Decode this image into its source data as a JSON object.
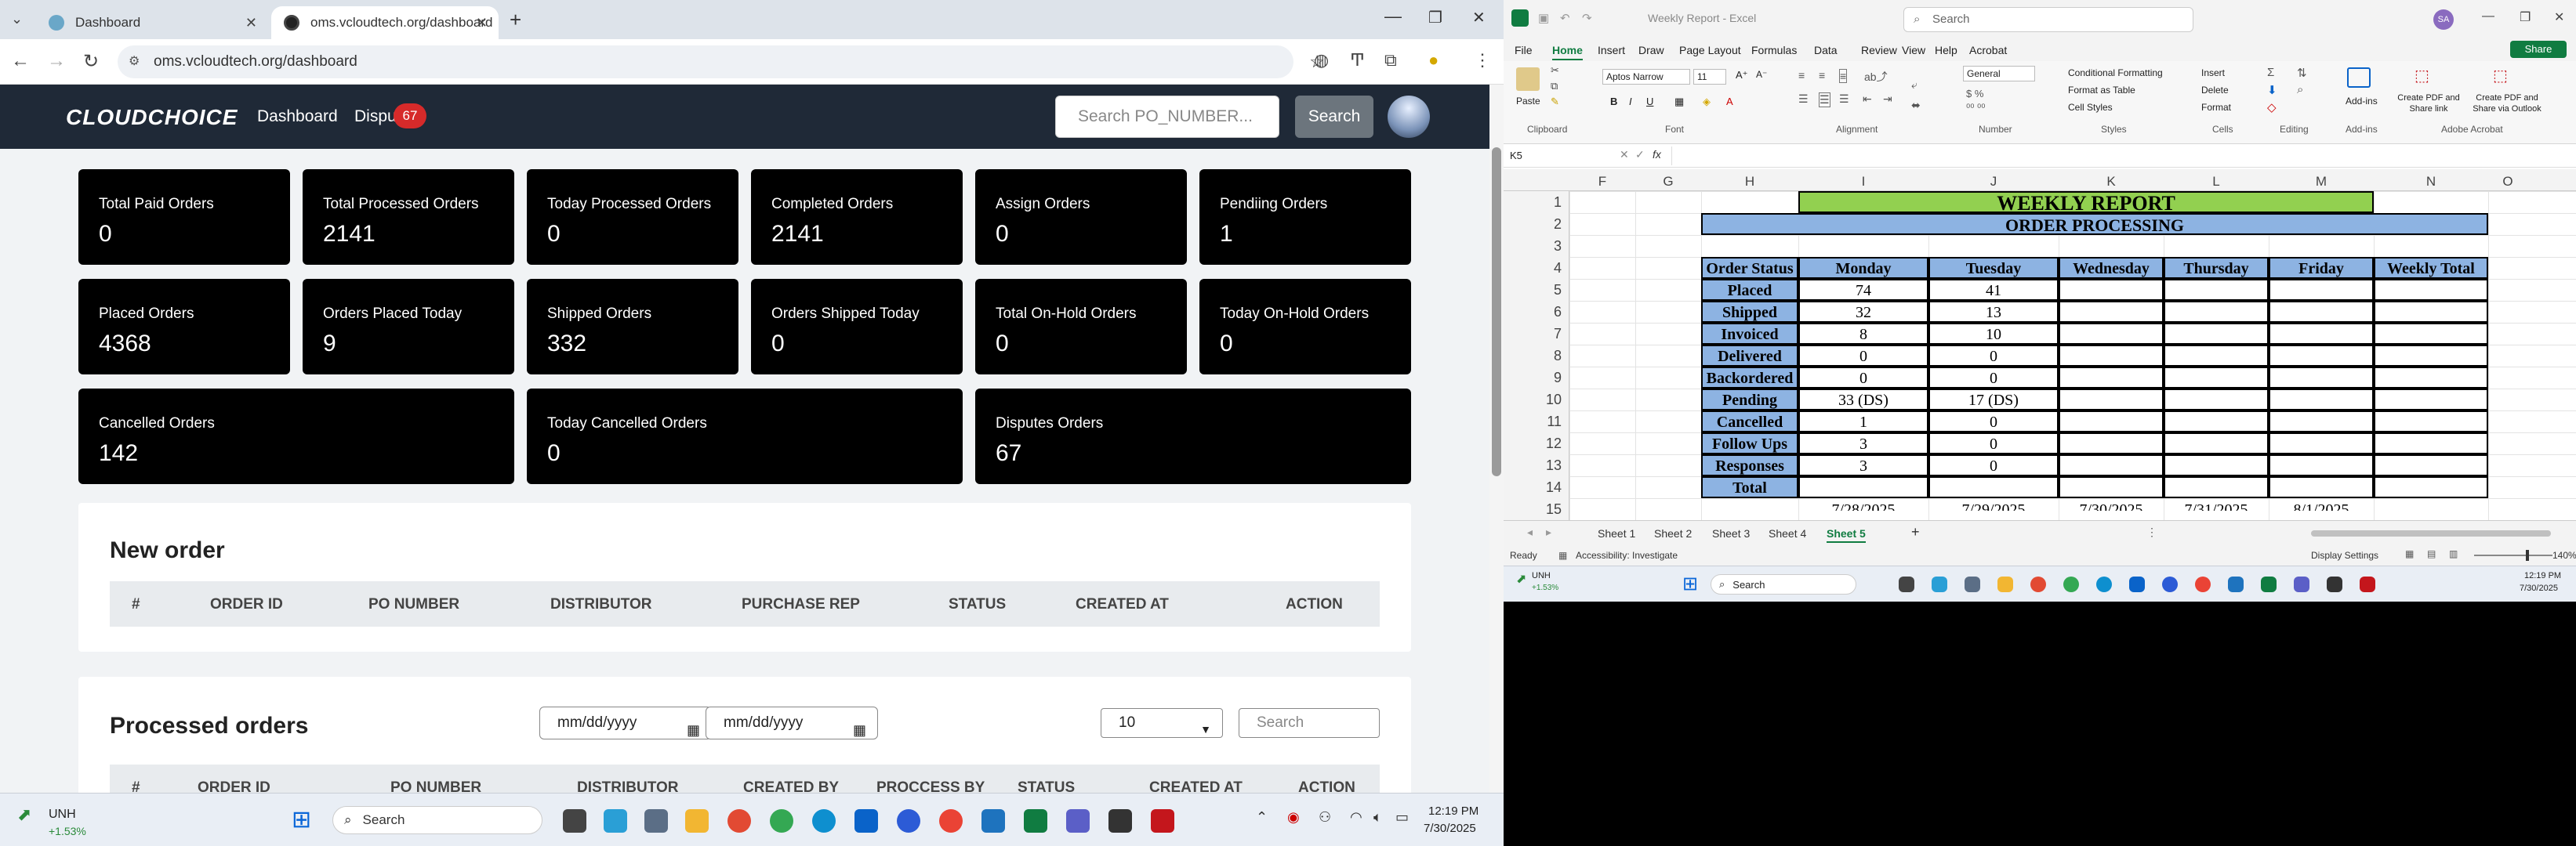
{
  "browser": {
    "tabs": [
      {
        "title": "Dashboard",
        "active": false
      },
      {
        "title": "oms.vcloudtech.org/dashboard",
        "active": true
      }
    ],
    "new_tab": "+",
    "url": "oms.vcloudtech.org/dashboard"
  },
  "app": {
    "logo": "CLOUDCHOICE",
    "nav": {
      "dashboard": "Dashboard",
      "disputes": "Dispu",
      "disputes_badge": "67"
    },
    "search_placeholder": "Search PO_NUMBER...",
    "search_button": "Search"
  },
  "cards": [
    {
      "label": "Total Paid Orders",
      "value": "0"
    },
    {
      "label": "Total Processed Orders",
      "value": "2141"
    },
    {
      "label": "Today Processed Orders",
      "value": "0"
    },
    {
      "label": "Completed Orders",
      "value": "2141"
    },
    {
      "label": "Assign Orders",
      "value": "0"
    },
    {
      "label": "Pendiing Orders",
      "value": "1"
    },
    {
      "label": "Placed Orders",
      "value": "4368"
    },
    {
      "label": "Orders Placed Today",
      "value": "9"
    },
    {
      "label": "Shipped Orders",
      "value": "332"
    },
    {
      "label": "Orders Shipped Today",
      "value": "0"
    },
    {
      "label": "Total On-Hold Orders",
      "value": "0"
    },
    {
      "label": "Today On-Hold Orders",
      "value": "0"
    },
    {
      "label": "Cancelled Orders",
      "value": "142"
    },
    {
      "label": "Today Cancelled Orders",
      "value": "0"
    },
    {
      "label": "Disputes Orders",
      "value": "67"
    }
  ],
  "new_order": {
    "title": "New order",
    "columns": [
      "#",
      "ORDER ID",
      "PO NUMBER",
      "DISTRIBUTOR",
      "PURCHASE REP",
      "STATUS",
      "CREATED AT",
      "ACTION"
    ]
  },
  "processed": {
    "title": "Processed orders",
    "date_from": "mm/dd/yyyy",
    "date_to": "mm/dd/yyyy",
    "page_size": "10",
    "search_placeholder": "Search",
    "columns": [
      "#",
      "ORDER ID",
      "PO NUMBER",
      "DISTRIBUTOR",
      "CREATED BY",
      "PROCCESS BY",
      "STATUS",
      "CREATED AT",
      "ACTION"
    ]
  },
  "taskbar": {
    "stock_name": "UNH",
    "stock_change": "+1.53%",
    "search": "Search",
    "time": "12:19 PM",
    "date": "7/30/2025"
  },
  "excel": {
    "title": "Weekly Report - Excel",
    "search": "Search",
    "user_initials": "SA",
    "menu": [
      "File",
      "Home",
      "Insert",
      "Draw",
      "Page Layout",
      "Formulas",
      "Data",
      "Review",
      "View",
      "Help",
      "Acrobat"
    ],
    "share": "Share",
    "ribbon": {
      "paste": "Paste",
      "clipboard": "Clipboard",
      "font_name": "Aptos Narrow",
      "font_size": "11",
      "font": "Font",
      "alignment": "Alignment",
      "number_format": "General",
      "number": "Number",
      "conditional_formatting": "Conditional Formatting",
      "format_as_table": "Format as Table",
      "cell_styles": "Cell Styles",
      "styles": "Styles",
      "insert": "Insert",
      "delete": "Delete",
      "format": "Format",
      "cells": "Cells",
      "editing": "Editing",
      "addins": "Add-ins",
      "addins_label": "Add-ins",
      "create_pdf_share": "Create PDF and Share link",
      "create_pdf_outlook": "Create PDF and Share via Outlook",
      "adobe_acrobat": "Adobe Acrobat"
    },
    "name_box": "K5",
    "fx": "fx",
    "columns": [
      "F",
      "G",
      "H",
      "I",
      "J",
      "K",
      "L",
      "M",
      "N",
      "O"
    ],
    "rows": [
      "1",
      "2",
      "3",
      "4",
      "5",
      "6",
      "7",
      "8",
      "9",
      "10",
      "11",
      "12",
      "13",
      "14",
      "15"
    ],
    "report_title": "WEEKLY REPORT",
    "report_subtitle": "ORDER PROCESSING",
    "table_header": [
      "Order Status",
      "Monday",
      "Tuesday",
      "Wednesday",
      "Thursday",
      "Friday",
      "Weekly Total"
    ],
    "table_rows": [
      [
        "Placed",
        "74",
        "41",
        "",
        "",
        "",
        ""
      ],
      [
        "Shipped",
        "32",
        "13",
        "",
        "",
        "",
        ""
      ],
      [
        "Invoiced",
        "8",
        "10",
        "",
        "",
        "",
        ""
      ],
      [
        "Delivered",
        "0",
        "0",
        "",
        "",
        "",
        ""
      ],
      [
        "Backordered",
        "0",
        "0",
        "",
        "",
        "",
        ""
      ],
      [
        "Pending",
        "33 (DS)",
        "17 (DS)",
        "",
        "",
        "",
        ""
      ],
      [
        "Cancelled",
        "1",
        "0",
        "",
        "",
        "",
        ""
      ],
      [
        "Follow Ups",
        "3",
        "0",
        "",
        "",
        "",
        ""
      ],
      [
        "Responses",
        "3",
        "0",
        "",
        "",
        "",
        ""
      ],
      [
        "Total",
        "",
        "",
        "",
        "",
        "",
        ""
      ]
    ],
    "row15": [
      "7/28/2025",
      "7/29/2025",
      "7/30/2025",
      "7/31/2025",
      "8/1/2025"
    ],
    "sheets": [
      "Sheet 1",
      "Sheet 2",
      "Sheet 3",
      "Sheet 4",
      "Sheet 5"
    ],
    "active_sheet": "Sheet 5",
    "status_ready": "Ready",
    "accessibility": "Accessibility: Investigate",
    "display_settings": "Display Settings",
    "zoom": "140%",
    "colors": {
      "title_fill": "#92d050",
      "header_fill": "#8db3e2",
      "accent": "#107c41"
    }
  },
  "taskbar2": {
    "stock_name": "UNH",
    "stock_change": "+1.53%",
    "search": "Search",
    "time": "12:19 PM",
    "date": "7/30/2025"
  }
}
